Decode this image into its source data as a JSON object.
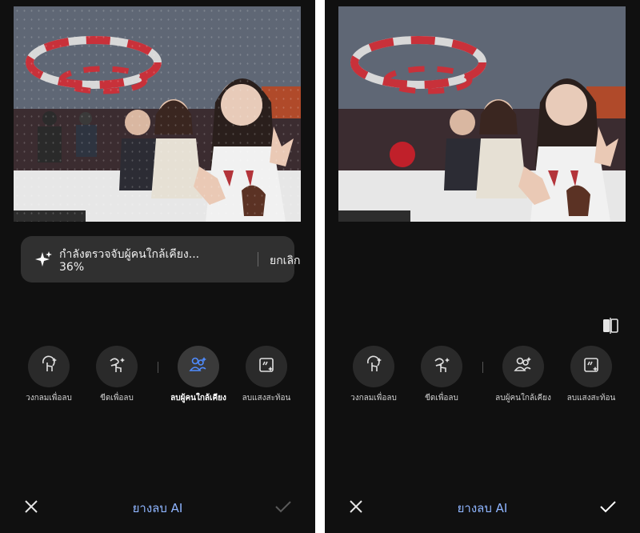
{
  "screens": {
    "left": {
      "progress": {
        "status": "กำลังตรวจจับผู้คนใกล้เคียง...",
        "percent_text": "36%",
        "percent_value": 36,
        "cancel_label": "ยกเลิก",
        "icon": "sparkle-icon"
      },
      "tools": [
        {
          "label": "วงกลมเพื่อลบ",
          "icon": "lasso-tap-icon",
          "active": false
        },
        {
          "label": "ขีดเพื่อลบ",
          "icon": "scribble-tap-icon",
          "active": false
        },
        {
          "label": "ลบผู้คนใกล้เคียง",
          "icon": "people-sparkle-icon",
          "active": true
        },
        {
          "label": "ลบแสงสะท้อน",
          "icon": "reflection-sparkle-icon",
          "active": false
        }
      ],
      "title": "ยางลบ AI",
      "done_enabled": false
    },
    "right": {
      "tools": [
        {
          "label": "วงกลมเพื่อลบ",
          "icon": "lasso-tap-icon",
          "active": false
        },
        {
          "label": "ขีดเพื่อลบ",
          "icon": "scribble-tap-icon",
          "active": false
        },
        {
          "label": "ลบผู้คนใกล้เคียง",
          "icon": "people-sparkle-icon",
          "active": false
        },
        {
          "label": "ลบแสงสะท้อน",
          "icon": "reflection-sparkle-icon",
          "active": false
        }
      ],
      "title": "ยางลบ AI",
      "done_enabled": true,
      "compare_icon": "compare-icon"
    }
  },
  "colors": {
    "background": "#101010",
    "accent": "#8fb5ff",
    "active_tool": "#4f8cff",
    "toast_background": "#303030"
  }
}
